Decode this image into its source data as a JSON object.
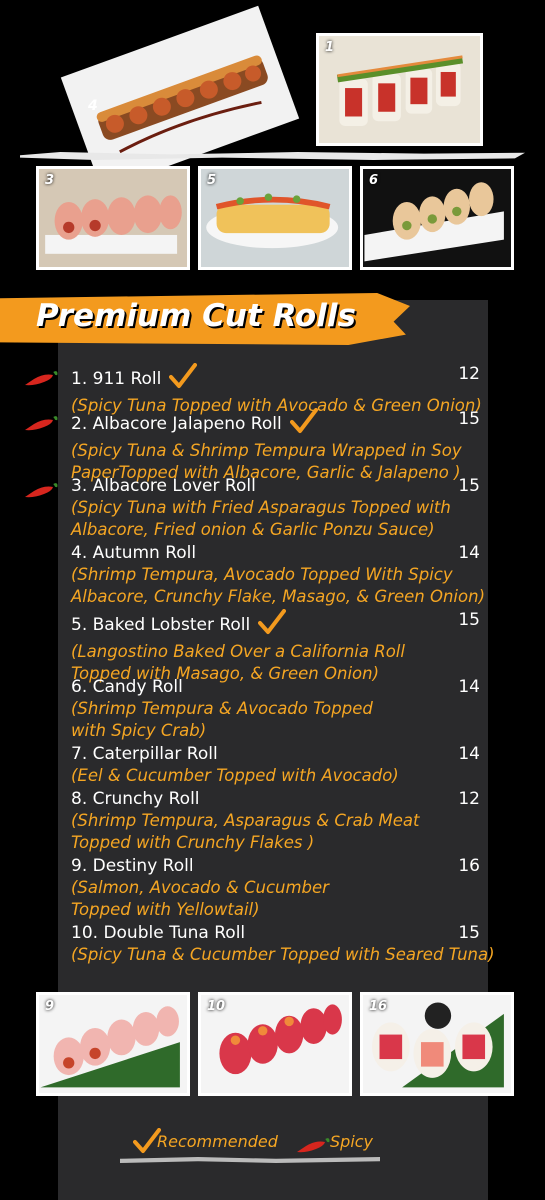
{
  "photos": {
    "top_left_label": "4",
    "top_right_label": "1",
    "mid_1_label": "3",
    "mid_2_label": "5",
    "mid_3_label": "6",
    "bottom_1_label": "9",
    "bottom_2_label": "10",
    "bottom_3_label": "16"
  },
  "section": {
    "title": "Premium Cut Rolls"
  },
  "items": [
    {
      "name": "1. 911 Roll",
      "price": "12",
      "desc": [
        "(Spicy Tuna Topped with Avocado & Green Onion)"
      ],
      "spicy": true,
      "recommended": true
    },
    {
      "name": "2. Albacore Jalapeno Roll",
      "price": "15",
      "desc": [
        "(Spicy Tuna & Shrimp Tempura Wrapped in Soy",
        "PaperTopped with Albacore, Garlic & Jalapeno )"
      ],
      "spicy": true,
      "recommended": true
    },
    {
      "name": "3. Albacore Lover Roll",
      "price": "15",
      "desc": [
        "(Spicy Tuna with Fried Asparagus Topped with",
        "Albacore, Fried onion & Garlic Ponzu Sauce)"
      ],
      "spicy": true,
      "recommended": false
    },
    {
      "name": "4. Autumn Roll",
      "price": "14",
      "desc": [
        "(Shrimp Tempura, Avocado Topped With Spicy",
        "Albacore, Crunchy Flake, Masago, & Green Onion)"
      ],
      "spicy": false,
      "recommended": false
    },
    {
      "name": "5. Baked Lobster Roll",
      "price": "15",
      "desc": [
        "(Langostino Baked Over a California Roll",
        "Topped with Masago, & Green Onion)"
      ],
      "spicy": false,
      "recommended": true
    },
    {
      "name": "6. Candy Roll",
      "price": "14",
      "desc": [
        "(Shrimp Tempura & Avocado Topped",
        "with Spicy Crab)"
      ],
      "spicy": false,
      "recommended": false
    },
    {
      "name": "7. Caterpillar Roll",
      "price": "14",
      "desc": [
        "(Eel & Cucumber Topped with Avocado)"
      ],
      "spicy": false,
      "recommended": false
    },
    {
      "name": "8. Crunchy Roll",
      "price": "12",
      "desc": [
        "(Shrimp Tempura, Asparagus & Crab Meat",
        "Topped with Crunchy Flakes )"
      ],
      "spicy": false,
      "recommended": false
    },
    {
      "name": "9. Destiny Roll",
      "price": "16",
      "desc": [
        "(Salmon, Avocado & Cucumber",
        "Topped with Yellowtail)"
      ],
      "spicy": false,
      "recommended": false
    },
    {
      "name": "10. Double Tuna Roll",
      "price": "15",
      "desc": [
        "(Spicy Tuna & Cucumber Topped with Seared Tuna)"
      ],
      "spicy": false,
      "recommended": false
    }
  ],
  "legend": {
    "recommended": "Recommended",
    "spicy": "Spicy"
  },
  "colors": {
    "accent": "#f39a1e",
    "description": "#f5a623",
    "panel": "#2a2a2c",
    "pepper": "#d7261e"
  }
}
